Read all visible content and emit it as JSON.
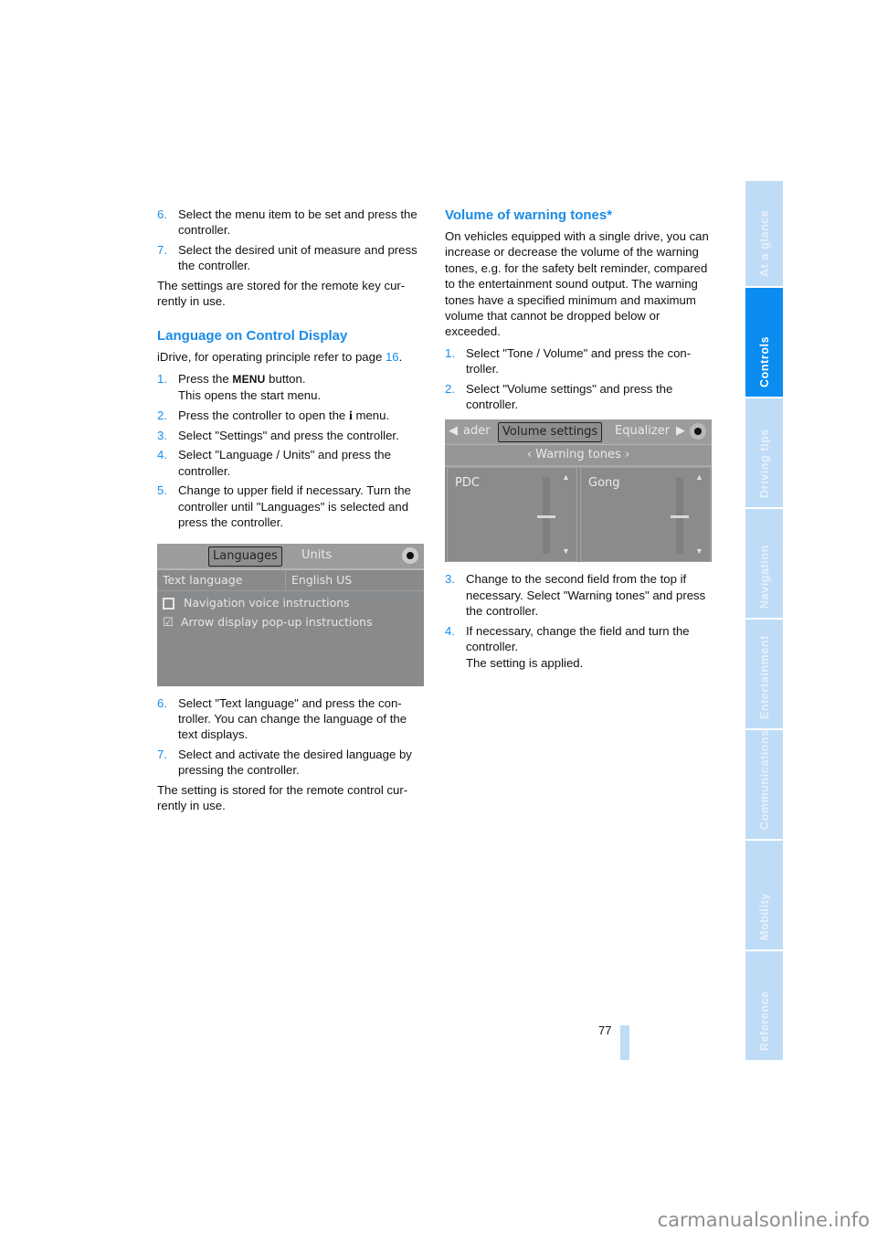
{
  "left_column": {
    "intro_steps": [
      {
        "num": "6.",
        "text": "Select the menu item to be set and press the controller."
      },
      {
        "num": "7.",
        "text": "Select the desired unit of measure and press the controller."
      }
    ],
    "intro_note": "The settings are stored for the remote key cur-rently in use.",
    "section_title": "Language on Control Display",
    "idrive_prefix": "iDrive, for operating principle refer to page ",
    "idrive_page_link": "16",
    "idrive_suffix": ".",
    "step1": {
      "num": "1.",
      "pre": "Press the ",
      "glyph": "MENU",
      "post": " button.",
      "line2": "This opens the start menu."
    },
    "step2": {
      "num": "2.",
      "pre": "Press the controller to open the ",
      "glyph": "i",
      "post": " menu."
    },
    "steps_3_5": [
      {
        "num": "3.",
        "text": "Select \"Settings\" and press the controller."
      },
      {
        "num": "4.",
        "text": "Select \"Language / Units\" and press the controller."
      },
      {
        "num": "5.",
        "text": "Change to upper field if necessary. Turn the controller until \"Languages\" is selected and press the controller."
      }
    ],
    "screen": {
      "tabs": [
        "Languages",
        "Units"
      ],
      "selected_tab": "Languages",
      "field_label": "Text language",
      "field_value": "English US",
      "options": [
        {
          "label": "Navigation voice instructions",
          "checked": false
        },
        {
          "label": "Arrow display pop-up instructions",
          "checked": true
        }
      ],
      "controller_icon": "controller-joystick-icon"
    },
    "steps_6_7": [
      {
        "num": "6.",
        "text": "Select \"Text language\" and press the con-troller. You can change the language of the text displays."
      },
      {
        "num": "7.",
        "text": "Select and activate the desired language by pressing the controller."
      }
    ],
    "end_note": "The setting is stored for the remote control cur-rently in use."
  },
  "right_column": {
    "section_title": "Volume of warning tones*",
    "intro": "On vehicles equipped with a single drive, you can increase or decrease the volume of the warning tones, e.g. for the safety belt reminder, compared to the entertainment sound output. The warning tones have a specified minimum and maximum volume that cannot be dropped below or exceeded.",
    "steps_1_2": [
      {
        "num": "1.",
        "text": "Select \"Tone / Volume\" and press the con-troller."
      },
      {
        "num": "2.",
        "text": "Select \"Volume settings\" and press the controller."
      }
    ],
    "screen": {
      "tabs": [
        "ader",
        "Volume settings",
        "Equalizer"
      ],
      "selected_tab": "Volume settings",
      "subheader": "Warning tones",
      "panels": [
        {
          "label": "PDC",
          "level": 0.5
        },
        {
          "label": "Gong",
          "level": 0.5
        }
      ]
    },
    "steps_3_4": [
      {
        "num": "3.",
        "text": "Change to the second field from the top if necessary. Select \"Warning tones\" and press the controller."
      },
      {
        "num": "4.",
        "text": "If necessary, change the field and turn the controller.",
        "line2": "The setting is applied."
      }
    ]
  },
  "side_nav": {
    "items": [
      {
        "label": "At a glance",
        "active": false
      },
      {
        "label": "Controls",
        "active": true
      },
      {
        "label": "Driving tips",
        "active": false
      },
      {
        "label": "Navigation",
        "active": false
      },
      {
        "label": "Entertainment",
        "active": false
      },
      {
        "label": "Communications",
        "active": false
      },
      {
        "label": "Mobility",
        "active": false
      },
      {
        "label": "Reference",
        "active": false
      }
    ]
  },
  "page_number": "77",
  "watermark": "carmanualsonline.info",
  "colors": {
    "accent": "#1a8be6",
    "nav_active": "#0a8cf0",
    "nav_inactive": "#bfdcf7"
  }
}
